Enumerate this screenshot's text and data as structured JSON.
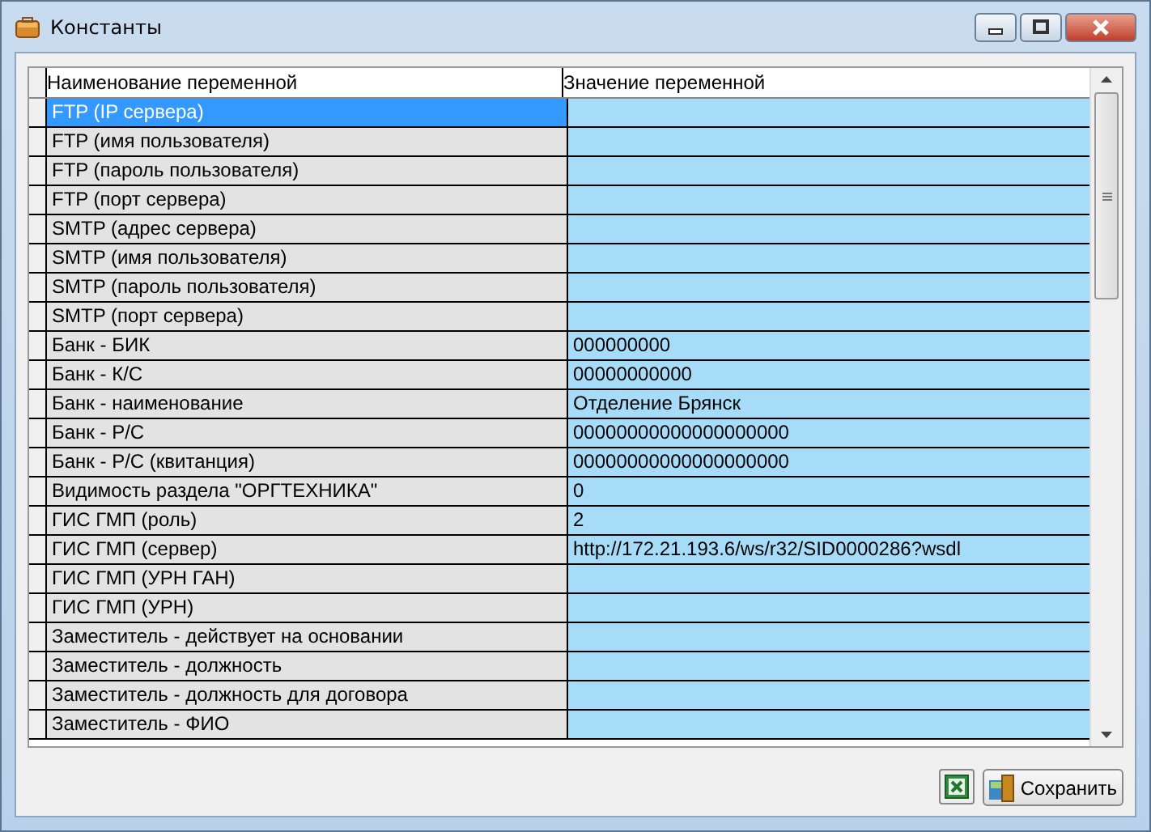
{
  "window": {
    "title": "Константы"
  },
  "table": {
    "columns": [
      "Наименование переменной",
      "Значение переменной"
    ],
    "rows": [
      {
        "name": "FTP (IP сервера)",
        "value": "",
        "selected": true
      },
      {
        "name": "FTP (имя пользователя)",
        "value": "",
        "selected": false
      },
      {
        "name": "FTP (пароль пользователя)",
        "value": "",
        "selected": false
      },
      {
        "name": "FTP (порт сервера)",
        "value": "",
        "selected": false
      },
      {
        "name": "SMTP (адрес сервера)",
        "value": "",
        "selected": false
      },
      {
        "name": "SMTP (имя пользователя)",
        "value": "",
        "selected": false
      },
      {
        "name": "SMTP (пароль пользователя)",
        "value": "",
        "selected": false
      },
      {
        "name": "SMTP (порт сервера)",
        "value": "",
        "selected": false
      },
      {
        "name": "Банк - БИК",
        "value": "000000000",
        "selected": false
      },
      {
        "name": "Банк - К/С",
        "value": "00000000000",
        "selected": false
      },
      {
        "name": "Банк - наименование",
        "value": "Отделение Брянск",
        "selected": false
      },
      {
        "name": "Банк - Р/С",
        "value": "00000000000000000000",
        "selected": false
      },
      {
        "name": "Банк - Р/С (квитанция)",
        "value": "00000000000000000000",
        "selected": false
      },
      {
        "name": "Видимость раздела \"ОРГТЕХНИКА\"",
        "value": "0",
        "selected": false
      },
      {
        "name": "ГИС ГМП (роль)",
        "value": "2",
        "selected": false
      },
      {
        "name": "ГИС ГМП (сервер)",
        "value": "http://172.21.193.6/ws/r32/SID0000286?wsdl",
        "selected": false
      },
      {
        "name": "ГИС ГМП (УРН ГАН)",
        "value": "",
        "selected": false
      },
      {
        "name": "ГИС ГМП (УРН)",
        "value": "",
        "selected": false
      },
      {
        "name": "Заместитель - действует на основании",
        "value": "",
        "selected": false
      },
      {
        "name": "Заместитель - должность",
        "value": "",
        "selected": false
      },
      {
        "name": "Заместитель - должность для договора",
        "value": "",
        "selected": false
      },
      {
        "name": "Заместитель - ФИО",
        "value": "",
        "selected": false
      }
    ]
  },
  "buttons": {
    "save": "Сохранить"
  }
}
